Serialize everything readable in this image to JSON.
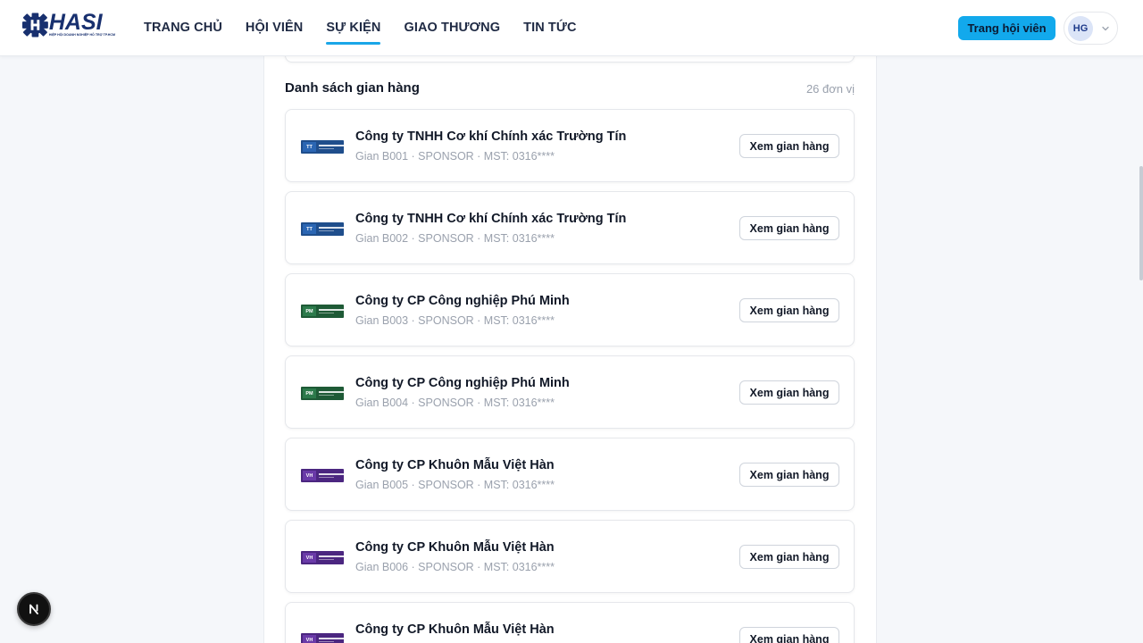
{
  "brand": {
    "name": "HASI",
    "tagline": "HIỆP HỘI DOANH NGHIỆP HỖ TRỢ TP.HCM",
    "color": "#18306f"
  },
  "nav": {
    "items": [
      {
        "label": "TRANG CHỦ",
        "active": false
      },
      {
        "label": "HỘI VIÊN",
        "active": false
      },
      {
        "label": "SỰ KIỆN",
        "active": true
      },
      {
        "label": "GIAO THƯƠNG",
        "active": false
      },
      {
        "label": "TIN TỨC",
        "active": false
      }
    ],
    "accent": "#1aa6e8"
  },
  "header": {
    "member_button": "Trang hội viên",
    "avatar_initials": "HG",
    "user_menu_icon": "chevron-down-icon"
  },
  "booths_section": {
    "title": "Danh sách gian hàng",
    "count": "26 đơn vị",
    "view_label": "Xem gian hàng",
    "items": [
      {
        "name": "Công ty TNHH Cơ khí Chính xác Trường Tín",
        "meta": "Gian B001 · SPONSOR · MST: 0316****",
        "logo_initials": "TT",
        "logo_color": "#1f4e8c"
      },
      {
        "name": "Công ty TNHH Cơ khí Chính xác Trường Tín",
        "meta": "Gian B002 · SPONSOR · MST: 0316****",
        "logo_initials": "TT",
        "logo_color": "#1f4e8c"
      },
      {
        "name": "Công ty CP Công nghiệp Phú Minh",
        "meta": "Gian B003 · SPONSOR · MST: 0316****",
        "logo_initials": "PM",
        "logo_color": "#1e5a36"
      },
      {
        "name": "Công ty CP Công nghiệp Phú Minh",
        "meta": "Gian B004 · SPONSOR · MST: 0316****",
        "logo_initials": "PM",
        "logo_color": "#1e5a36"
      },
      {
        "name": "Công ty CP Khuôn Mẫu Việt Hàn",
        "meta": "Gian B005 · SPONSOR · MST: 0316****",
        "logo_initials": "VH",
        "logo_color": "#5b2d91"
      },
      {
        "name": "Công ty CP Khuôn Mẫu Việt Hàn",
        "meta": "Gian B006 · SPONSOR · MST: 0316****",
        "logo_initials": "VH",
        "logo_color": "#5b2d91"
      },
      {
        "name": "Công ty CP Khuôn Mẫu Việt Hàn",
        "meta": "",
        "logo_initials": "VH",
        "logo_color": "#5b2d91"
      }
    ]
  },
  "dev_badge": {
    "letter": "N",
    "icon": "nextjs-icon"
  }
}
